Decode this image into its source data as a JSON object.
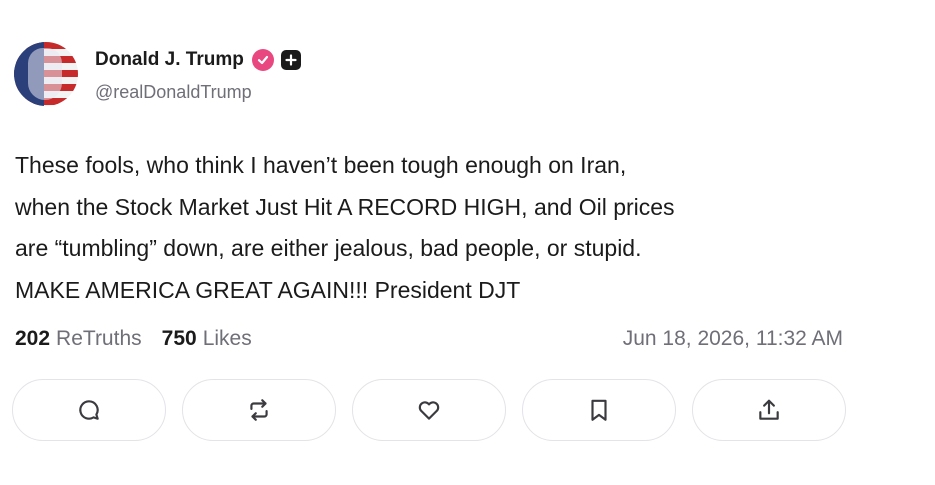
{
  "author": {
    "display_name": "Donald J. Trump",
    "handle": "@realDonaldTrump",
    "verified_icon": "verified-badge-icon",
    "follow_icon": "add-follow-icon"
  },
  "post": {
    "lines": [
      "These fools, who think I haven’t been tough enough on Iran,",
      "when the Stock Market Just Hit A RECORD HIGH, and Oil prices",
      "are “tumbling” down, are either jealous, bad people, or stupid.",
      "MAKE AMERICA GREAT AGAIN!!! President DJT"
    ]
  },
  "stats": {
    "retruths_count": "202",
    "retruths_label": "ReTruths",
    "likes_count": "750",
    "likes_label": "Likes",
    "timestamp": "Jun 18, 2026, 11:32 AM"
  },
  "actions": [
    "reply-icon",
    "retruth-icon",
    "like-icon",
    "bookmark-icon",
    "share-icon"
  ],
  "colors": {
    "verified_badge": "#e8487f",
    "muted_text": "#6f6f78",
    "primary_text": "#1b1b1b",
    "button_border": "#e3e3e8"
  }
}
